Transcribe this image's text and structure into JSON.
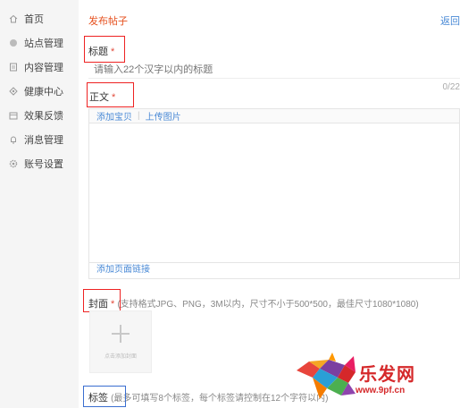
{
  "sidebar": {
    "items": [
      {
        "label": "首页",
        "icon": "home-icon"
      },
      {
        "label": "站点管理",
        "icon": "globe-icon"
      },
      {
        "label": "内容管理",
        "icon": "document-icon"
      },
      {
        "label": "健康中心",
        "icon": "diamond-icon"
      },
      {
        "label": "效果反馈",
        "icon": "feedback-icon"
      },
      {
        "label": "消息管理",
        "icon": "bell-icon"
      },
      {
        "label": "账号设置",
        "icon": "gear-icon"
      }
    ]
  },
  "header": {
    "title": "发布帖子",
    "back": "返回"
  },
  "form": {
    "title_label": "标题",
    "title_placeholder": "请输入22个汉字以内的标题",
    "counter": "0/22",
    "body_label": "正文",
    "toolbar": {
      "add_item": "添加宝贝",
      "upload_image": "上传图片"
    },
    "add_link": "添加页面链接",
    "cover_label": "封面",
    "cover_hint": "(支持格式JPG、PNG，3M以内，尺寸不小于500*500，最佳尺寸1080*1080)",
    "cover_upload_text": "点击添加封面",
    "tags_label": "标签",
    "tags_hint": "(最多可填写8个标签，每个标签请控制在12个字符以内)",
    "required_mark": "*"
  },
  "watermark": {
    "brand": "乐发网",
    "url": "www.9pf.cn"
  },
  "colors": {
    "accent": "#e6511f",
    "link": "#4a8ad6",
    "required": "#e24a3b",
    "annotation_red": "#ee2222",
    "annotation_blue": "#3a6ed0"
  }
}
